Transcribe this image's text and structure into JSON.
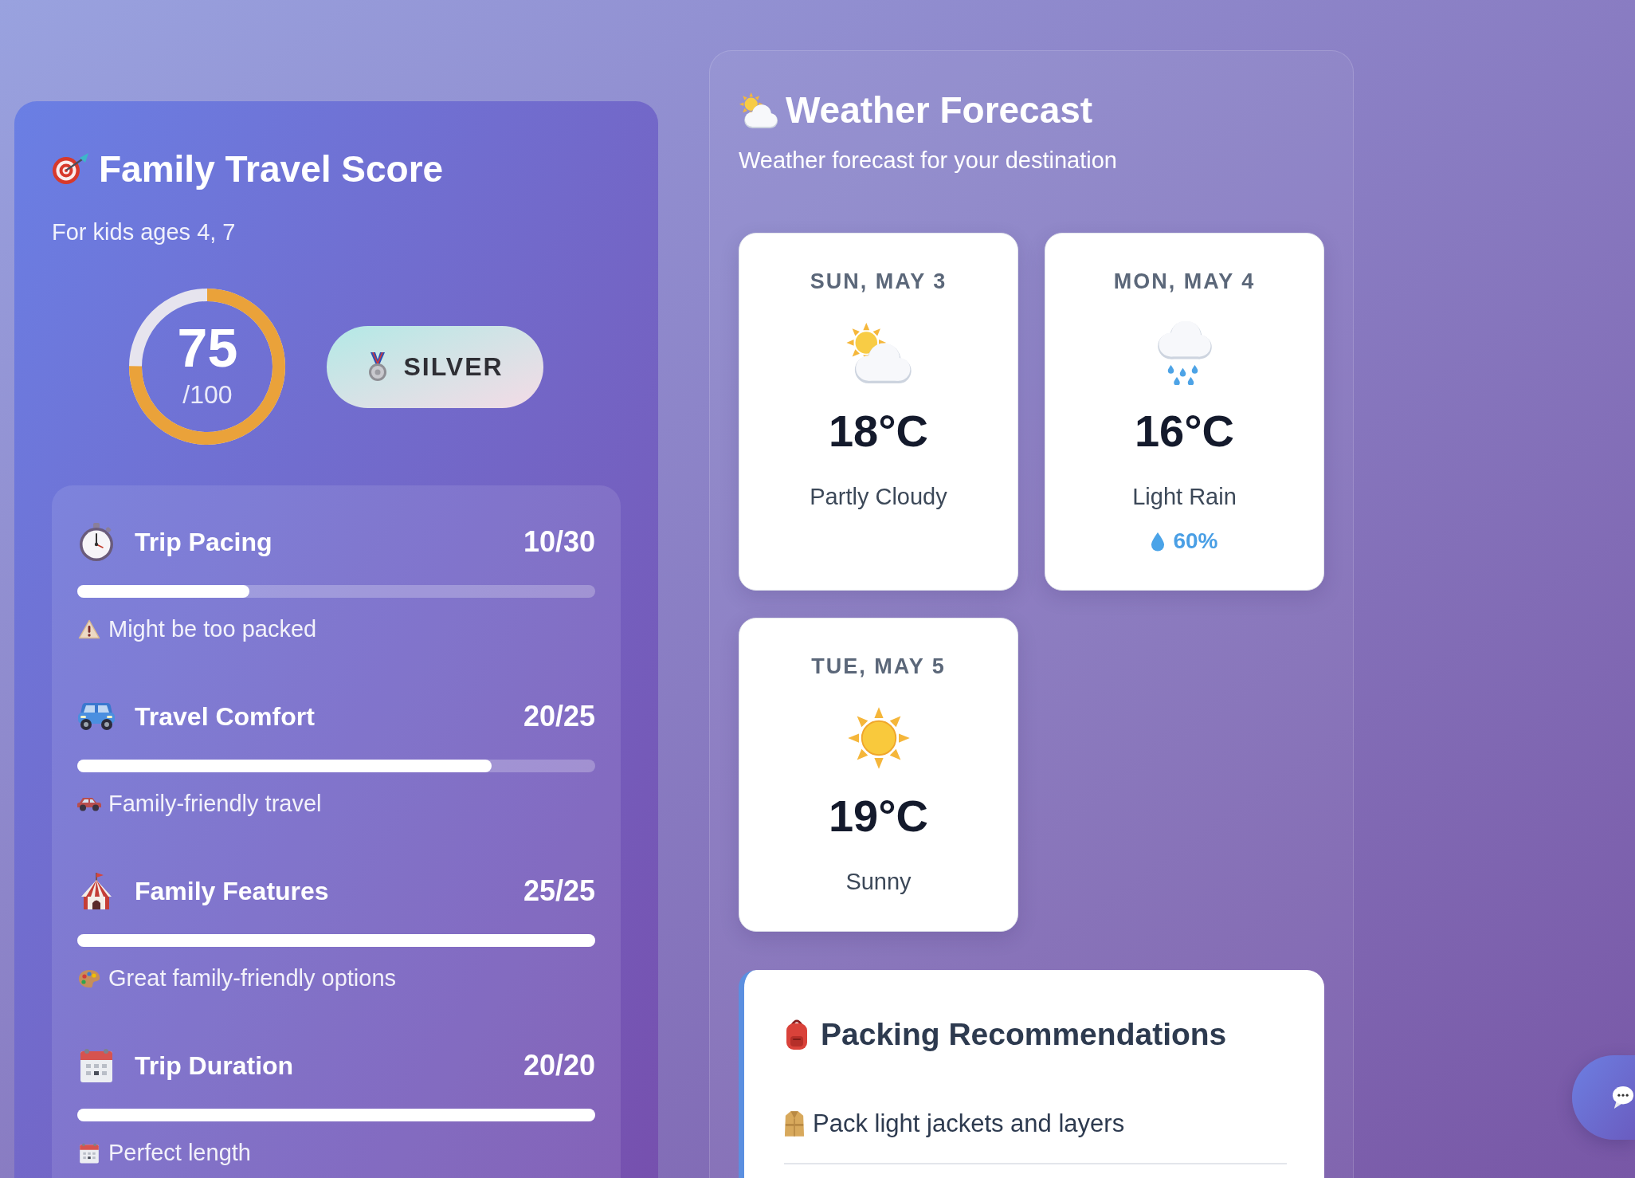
{
  "score_card": {
    "title": "Family Travel Score",
    "subtitle": "For kids ages 4, 7",
    "score": {
      "value": "75",
      "max": "/100",
      "level": 0.75
    },
    "badge": {
      "label": "SILVER"
    },
    "metrics": [
      {
        "kind": "pacing",
        "label": "Trip Pacing",
        "score": "10/30",
        "level": 0.333,
        "note": "Might be too packed"
      },
      {
        "kind": "comfort",
        "label": "Travel Comfort",
        "score": "20/25",
        "level": 0.8,
        "note": "Family-friendly travel"
      },
      {
        "kind": "features",
        "label": "Family Features",
        "score": "25/25",
        "level": 1,
        "note": "Great family-friendly options"
      },
      {
        "kind": "duration",
        "label": "Trip Duration",
        "score": "20/20",
        "level": 1,
        "note": "Perfect length"
      }
    ]
  },
  "weather": {
    "title": "Weather Forecast",
    "subtitle": "Weather forecast for your destination",
    "days": [
      {
        "kind": "cloudy",
        "date": "SUN, MAY 3",
        "temp": "18°C",
        "condition": "Partly Cloudy"
      },
      {
        "kind": "rainy",
        "date": "MON, MAY 4",
        "temp": "16°C",
        "condition": "Light Rain",
        "precip": "60%"
      },
      {
        "kind": "sunny",
        "date": "TUE, MAY 5",
        "temp": "19°C",
        "condition": "Sunny"
      }
    ]
  },
  "packing": {
    "title": "Packing Recommendations",
    "items": [
      "Pack light jackets and layers"
    ]
  }
}
